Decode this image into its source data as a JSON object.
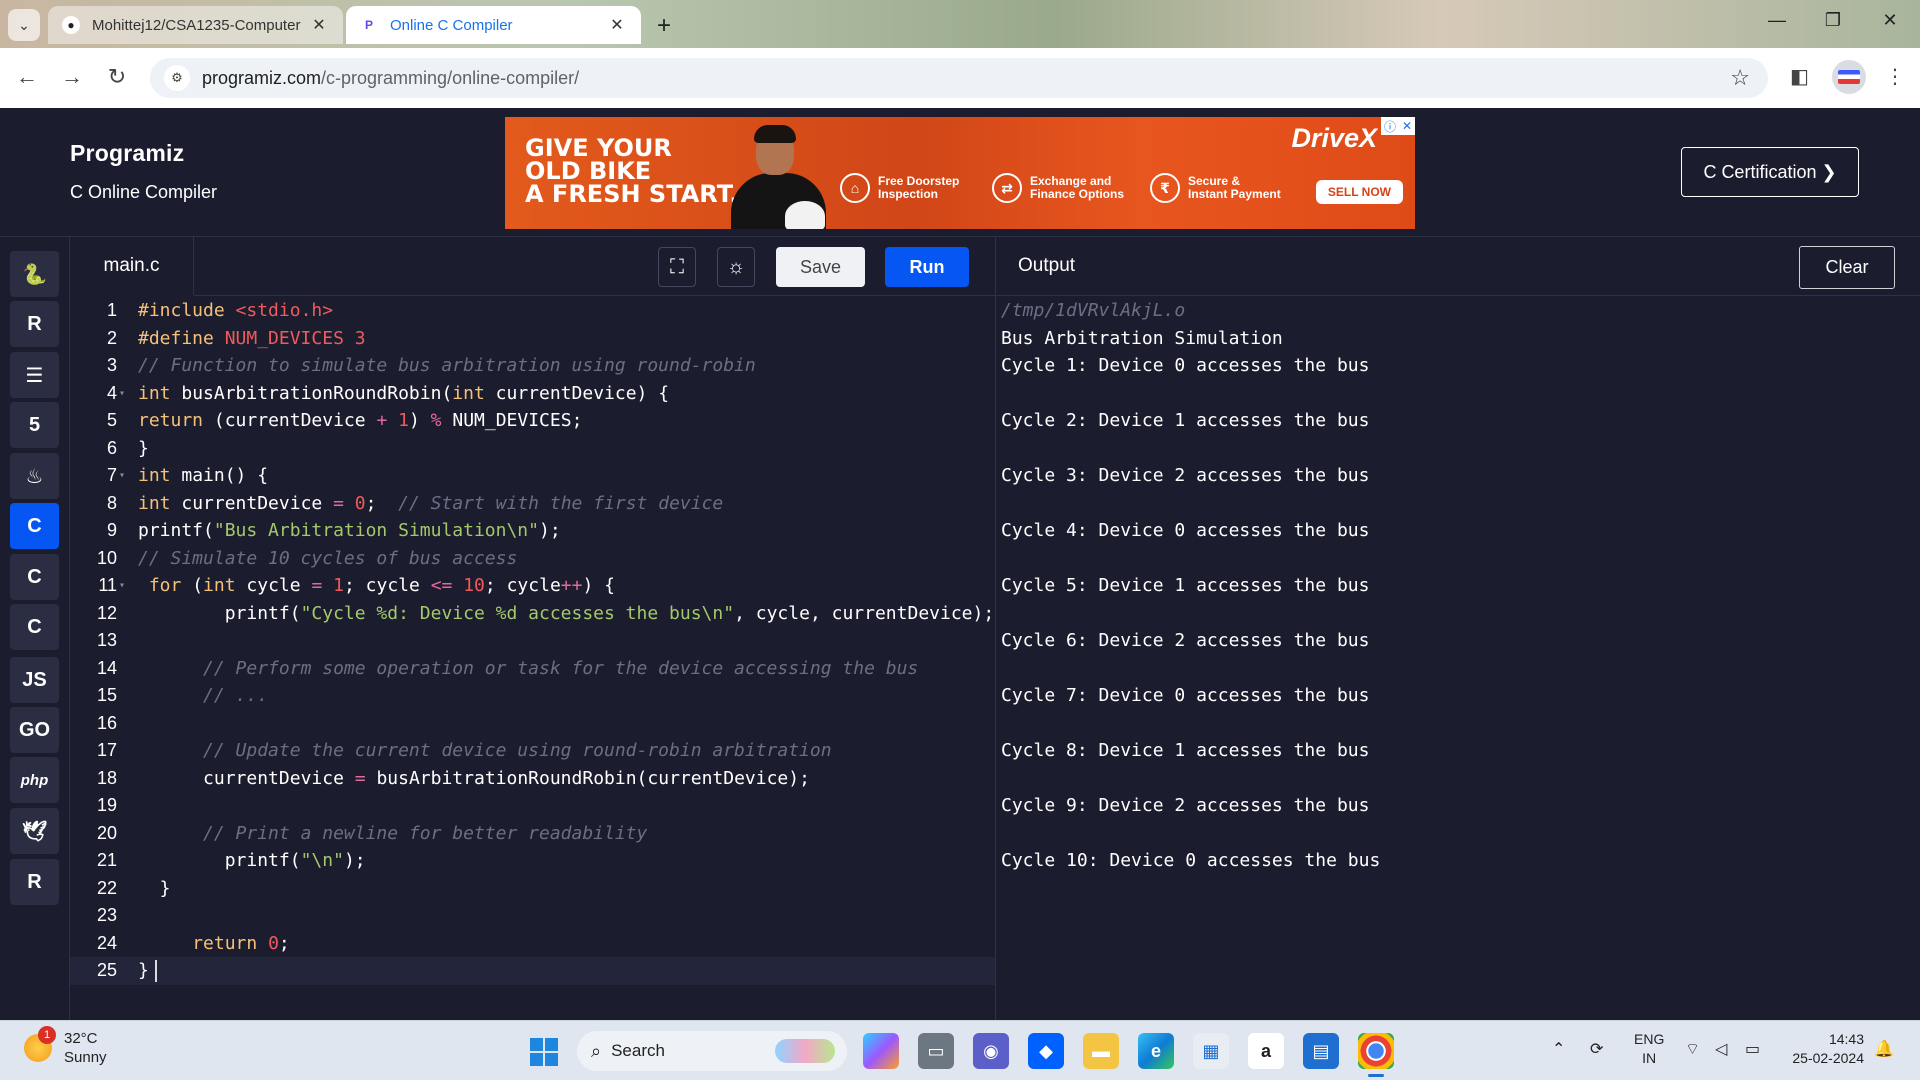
{
  "browser": {
    "tabs": [
      {
        "title": "Mohittej12/CSA1235-Computer",
        "favicon": "github-icon",
        "active": false
      },
      {
        "title": "Online C Compiler",
        "favicon": "programiz-icon",
        "active": true
      }
    ],
    "url_host": "programiz.com",
    "url_path": "/c-programming/online-compiler/"
  },
  "site": {
    "logo": "Programiz",
    "subtitle": "C Online Compiler",
    "certification_button": "C Certification ❯"
  },
  "ad": {
    "headline_1": "GIVE YOUR",
    "headline_2": "OLD BIKE",
    "headline_3": "A FRESH START.",
    "brand": "DriveX",
    "features": [
      {
        "l1": "Free Doorstep",
        "l2": "Inspection"
      },
      {
        "l1": "Exchange and",
        "l2": "Finance Options"
      },
      {
        "l1": "Secure &",
        "l2": "Instant Payment"
      }
    ],
    "cta": "SELL NOW"
  },
  "languages": [
    {
      "name": "python-icon",
      "glyph": "🐍"
    },
    {
      "name": "r-icon",
      "glyph": "R"
    },
    {
      "name": "sql-icon",
      "glyph": "☰"
    },
    {
      "name": "html-icon",
      "glyph": "5"
    },
    {
      "name": "java-icon",
      "glyph": "♨"
    },
    {
      "name": "c-icon",
      "glyph": "C"
    },
    {
      "name": "cpp-icon",
      "glyph": "C"
    },
    {
      "name": "csharp-icon",
      "glyph": "C"
    },
    {
      "name": "js-icon",
      "glyph": "JS"
    },
    {
      "name": "go-icon",
      "glyph": "GO"
    },
    {
      "name": "php-icon",
      "glyph": "php"
    },
    {
      "name": "swift-icon",
      "glyph": "🕊"
    },
    {
      "name": "rust-icon",
      "glyph": "R"
    }
  ],
  "editor": {
    "file_name": "main.c",
    "save_label": "Save",
    "run_label": "Run",
    "current_line": 25,
    "lines": [
      "#include <stdio.h>",
      "#define NUM_DEVICES 3",
      "// Function to simulate bus arbitration using round-robin",
      "int busArbitrationRoundRobin(int currentDevice) {",
      "return (currentDevice + 1) % NUM_DEVICES;",
      "}",
      "int main() {",
      "int currentDevice = 0;  // Start with the first device",
      "printf(\"Bus Arbitration Simulation\\n\");",
      "// Simulate 10 cycles of bus access",
      " for (int cycle = 1; cycle <= 10; cycle++) {",
      "        printf(\"Cycle %d: Device %d accesses the bus\\n\", cycle, currentDevice);",
      "",
      "      // Perform some operation or task for the device accessing the bus",
      "      // ...",
      "",
      "      // Update the current device using round-robin arbitration",
      "      currentDevice = busArbitrationRoundRobin(currentDevice);",
      "",
      "      // Print a newline for better readability",
      "        printf(\"\\n\");",
      "  }",
      "",
      "     return 0;",
      "}"
    ]
  },
  "output": {
    "title": "Output",
    "clear_label": "Clear",
    "lines": [
      "/tmp/1dVRvlAkjL.o",
      "Bus Arbitration Simulation",
      "Cycle 1: Device 0 accesses the bus",
      "",
      "Cycle 2: Device 1 accesses the bus",
      "",
      "Cycle 3: Device 2 accesses the bus",
      "",
      "Cycle 4: Device 0 accesses the bus",
      "",
      "Cycle 5: Device 1 accesses the bus",
      "",
      "Cycle 6: Device 2 accesses the bus",
      "",
      "Cycle 7: Device 0 accesses the bus",
      "",
      "Cycle 8: Device 1 accesses the bus",
      "",
      "Cycle 9: Device 2 accesses the bus",
      "",
      "Cycle 10: Device 0 accesses the bus"
    ]
  },
  "taskbar": {
    "temperature": "32°C",
    "condition": "Sunny",
    "weather_badge": "1",
    "search_placeholder": "Search",
    "lang_1": "ENG",
    "lang_2": "IN",
    "time": "14:43",
    "date": "25-02-2024"
  }
}
